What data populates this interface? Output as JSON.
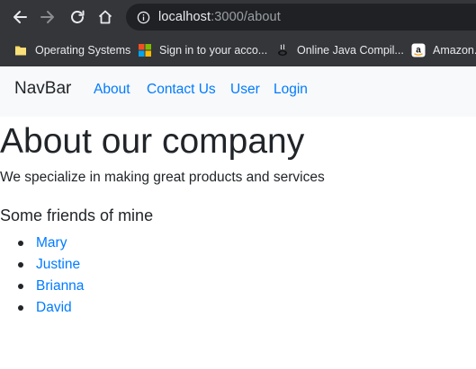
{
  "browser": {
    "url_host": "localhost",
    "url_rest": ":3000/about",
    "bookmarks": [
      {
        "label": "Operating Systems",
        "icon": "folder-icon"
      },
      {
        "label": "Sign in to your acco...",
        "icon": "microsoft-icon"
      },
      {
        "label": "Online Java Compil...",
        "icon": "java-icon"
      },
      {
        "label": "Amazon...",
        "icon": "amazon-icon"
      }
    ]
  },
  "navbar": {
    "brand": "NavBar",
    "links": [
      "About",
      "Contact Us",
      "User",
      "Login"
    ]
  },
  "page": {
    "title": "About our company",
    "lead": "We specialize in making great products and services",
    "subhead": "Some friends of mine",
    "friends": [
      "Mary",
      "Justine",
      "Brianna",
      "David"
    ]
  },
  "colors": {
    "chrome_bg": "#35363a",
    "omnibox_bg": "#202124",
    "navbar_bg": "#f8f9fa",
    "link": "#007bff",
    "text": "#212529"
  }
}
